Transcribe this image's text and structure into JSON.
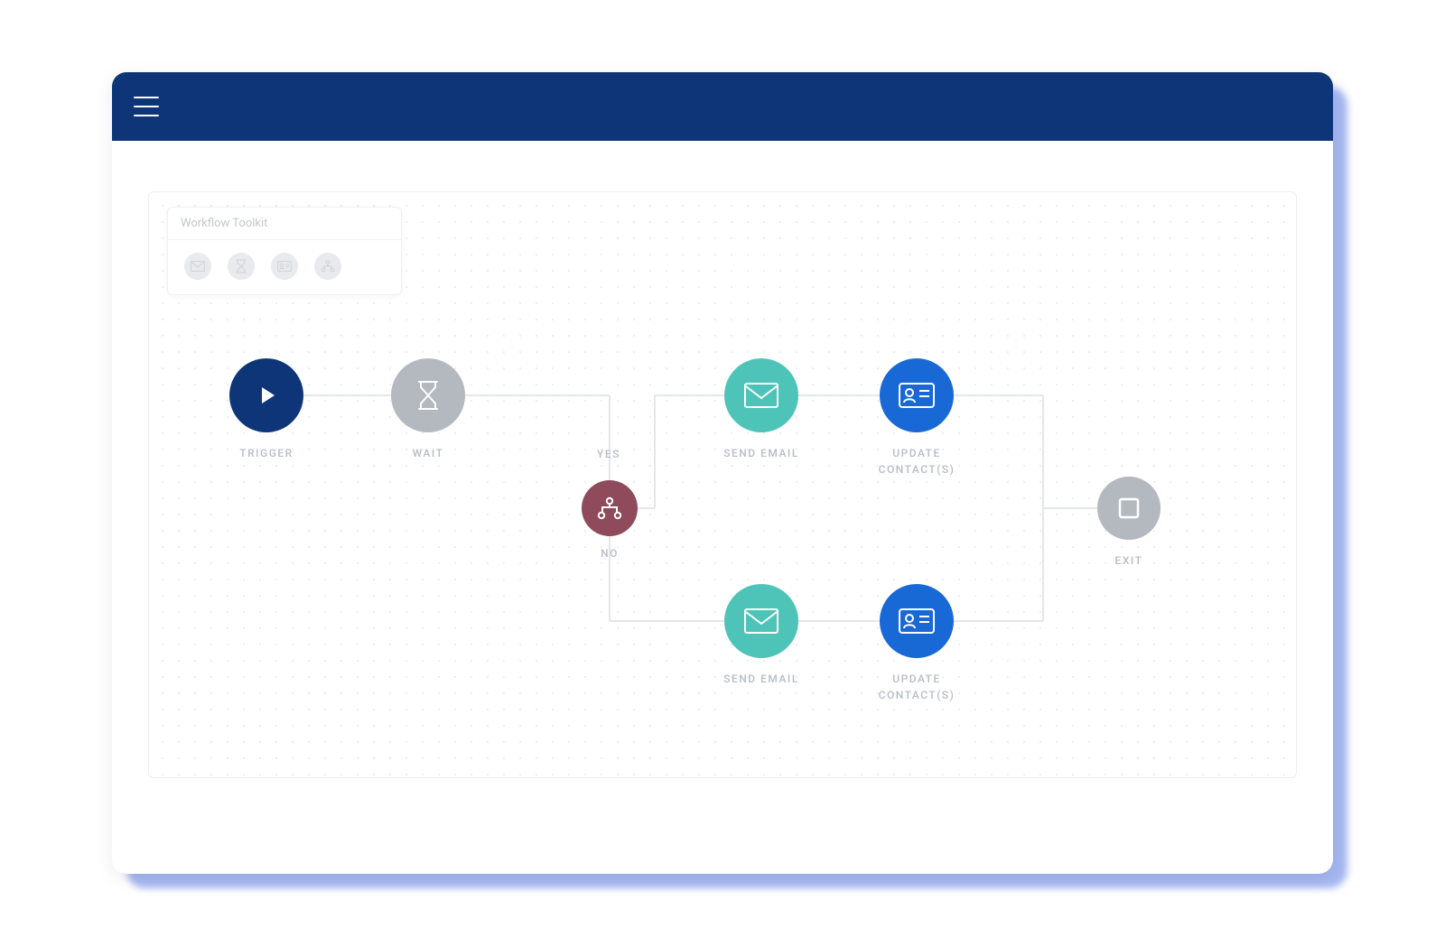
{
  "toolkit": {
    "title": "Workflow Toolkit",
    "items": [
      {
        "name": "email-icon"
      },
      {
        "name": "wait-icon"
      },
      {
        "name": "contact-icon"
      },
      {
        "name": "branch-icon"
      }
    ]
  },
  "nodes": {
    "trigger": {
      "label": "TRIGGER"
    },
    "wait": {
      "label": "WAIT"
    },
    "branch": {
      "yes_label": "YES",
      "no_label": "NO"
    },
    "send_email_top": {
      "label": "SEND EMAIL"
    },
    "send_email_bot": {
      "label": "SEND EMAIL"
    },
    "update_top": {
      "label": "UPDATE CONTACT(S)"
    },
    "update_bot": {
      "label": "UPDATE CONTACT(S)"
    },
    "exit": {
      "label": "EXIT"
    }
  },
  "colors": {
    "navy": "#0d3577",
    "gray": "#b4b8bf",
    "maroon": "#8f4a5c",
    "teal": "#4ec3b8",
    "blue": "#1869d6"
  }
}
